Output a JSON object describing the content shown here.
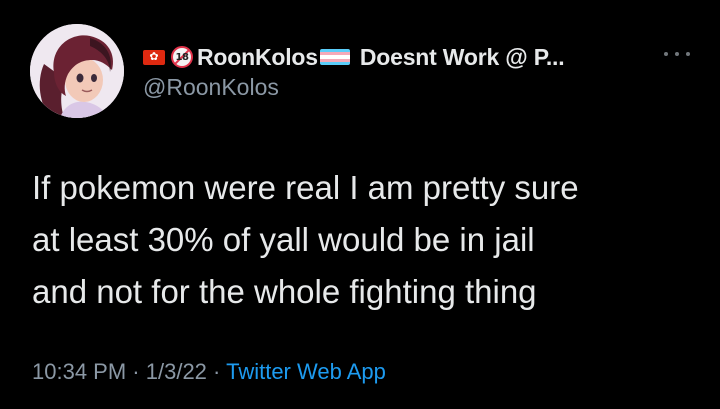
{
  "author": {
    "display_name": "RoonKolos",
    "display_name_suffix": "Doesnt Work @ P...",
    "handle": "@RoonKolos",
    "badges": [
      "hong-kong-flag-icon",
      "no-under-18-icon",
      "trans-flag-icon"
    ],
    "age_badge_text": "18"
  },
  "tweet": {
    "lines": [
      "If pokemon were real I am pretty sure",
      "at least 30% of yall would be in jail",
      "and not for the whole fighting thing"
    ]
  },
  "meta": {
    "time": "10:34 PM",
    "separator": "·",
    "date": "1/3/22",
    "source": "Twitter Web App"
  },
  "colors": {
    "background": "#000000",
    "text": "#e7e9ea",
    "secondary": "#8b98a5",
    "link": "#1d9bf0",
    "trans_blue": "#5bcefa",
    "trans_pink": "#f5a9b8",
    "trans_white": "#ffffff"
  }
}
